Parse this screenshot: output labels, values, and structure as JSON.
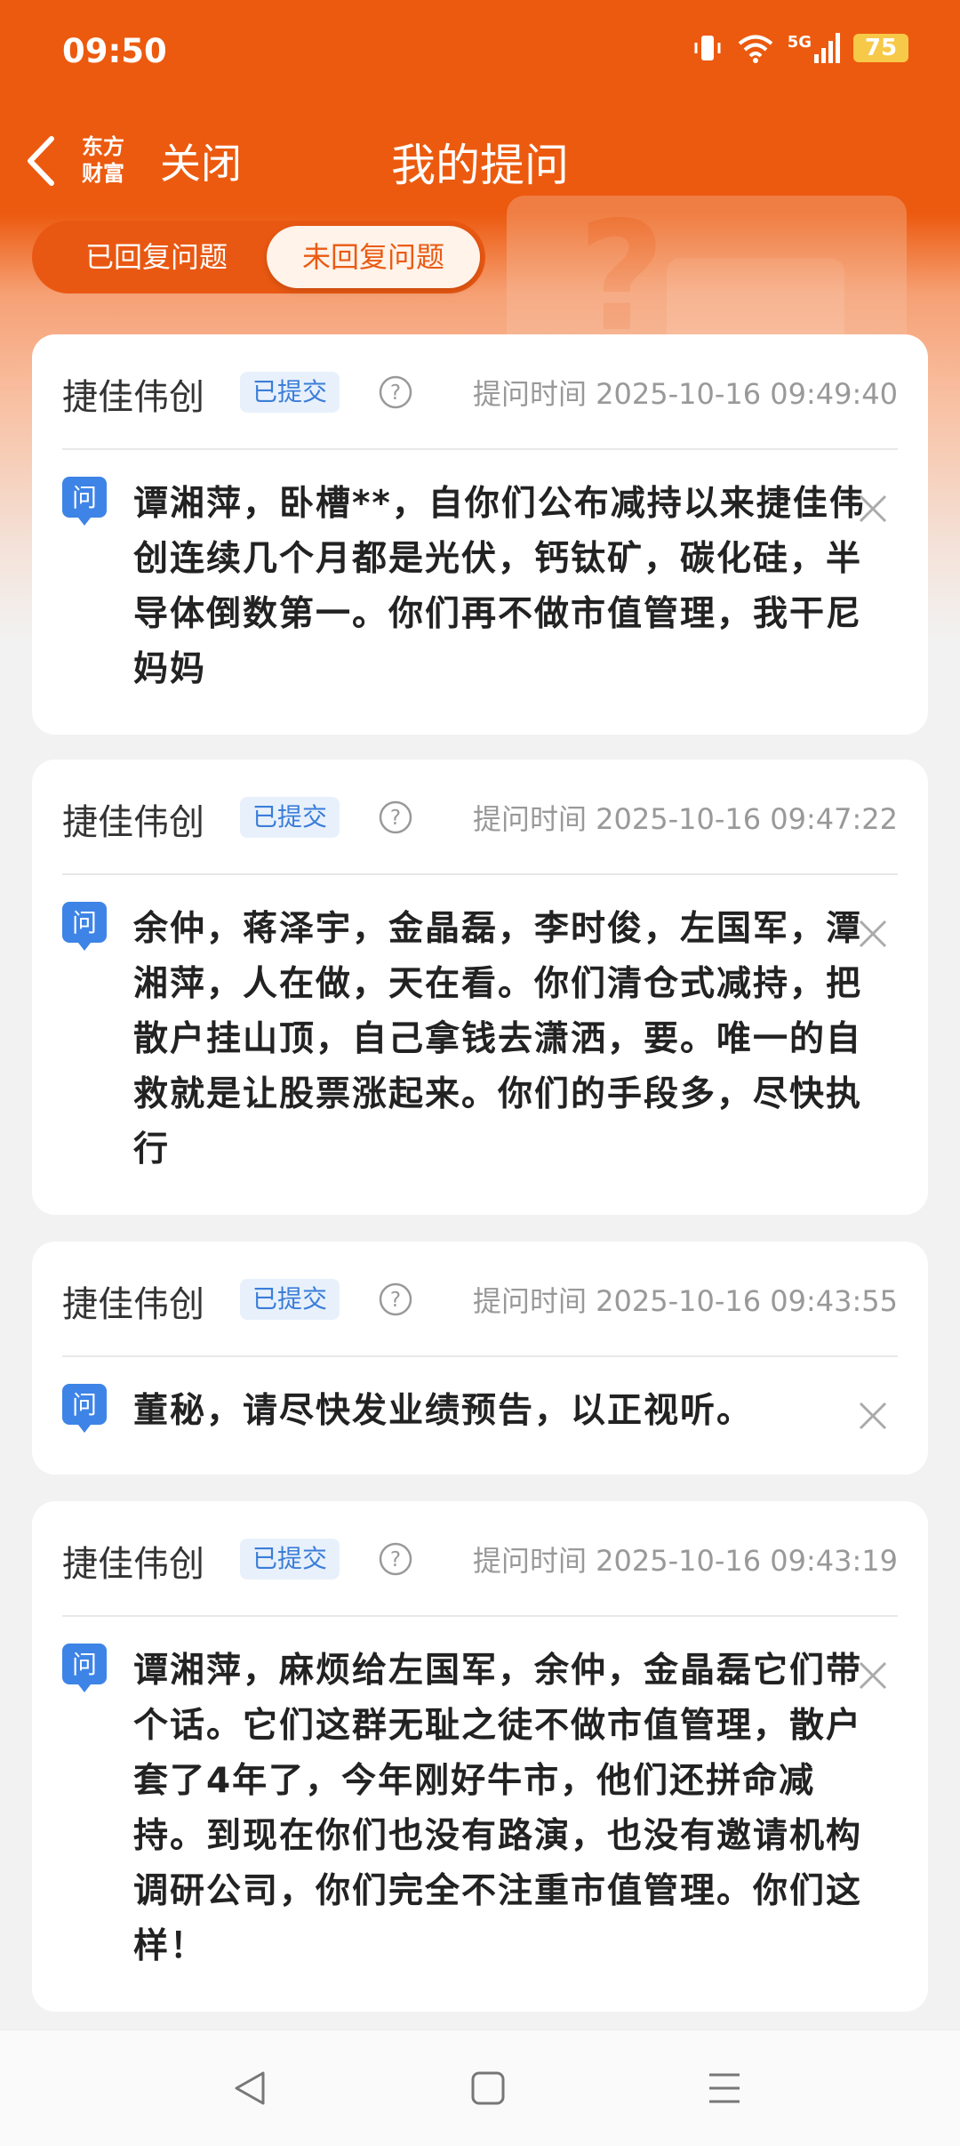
{
  "status_bar": {
    "time": "09:50",
    "network": "5G",
    "battery": "75"
  },
  "header": {
    "logo_line1": "东方",
    "logo_line2": "财富",
    "close_label": "关闭",
    "title": "我的提问"
  },
  "tabs": [
    {
      "label": "已回复问题",
      "selected": false
    },
    {
      "label": "未回复问题",
      "selected": true
    }
  ],
  "questions": [
    {
      "company": "捷佳伟创",
      "status": "已提交",
      "time": "提问时间 2025-10-16 09:49:40",
      "q_label": "问",
      "text": "谭湘萍，卧槽**，自你们公布减持以来捷佳伟创连续几个月都是光伏，钙钛矿，碳化硅，半导体倒数第一。你们再不做市值管理，我干尼妈妈"
    },
    {
      "company": "捷佳伟创",
      "status": "已提交",
      "time": "提问时间 2025-10-16 09:47:22",
      "q_label": "问",
      "text": "余仲，蒋泽宇，金晶磊，李时俊，左国军，潭湘萍，人在做，天在看。你们清仓式减持，把散户挂山顶，自己拿钱去潇洒，要。唯一的自救就是让股票涨起来。你们的手段多，尽快执行"
    },
    {
      "company": "捷佳伟创",
      "status": "已提交",
      "time": "提问时间 2025-10-16 09:43:55",
      "q_label": "问",
      "text": "董秘，请尽快发业绩预告，以正视听。"
    },
    {
      "company": "捷佳伟创",
      "status": "已提交",
      "time": "提问时间 2025-10-16 09:43:19",
      "q_label": "问",
      "text": "谭湘萍，麻烦给左国军，余仲，金晶磊它们带个话。它们这群无耻之徒不做市值管理，散户套了4年了，今年刚好牛市，他们还拼命减持。到现在你们也没有路演，也没有邀请机构调研公司，你们完全不注重市值管理。你们这样！"
    }
  ],
  "icons": {
    "back": "chevron-left-icon",
    "help": "question-circle-icon",
    "delete": "close-icon",
    "nav_back": "triangle-back-icon",
    "nav_home": "square-home-icon",
    "nav_menu": "menu-lines-icon"
  },
  "colors": {
    "brand": "#ec5a0f",
    "badge_text": "#3b7dd8",
    "q_icon": "#3d84e6"
  }
}
